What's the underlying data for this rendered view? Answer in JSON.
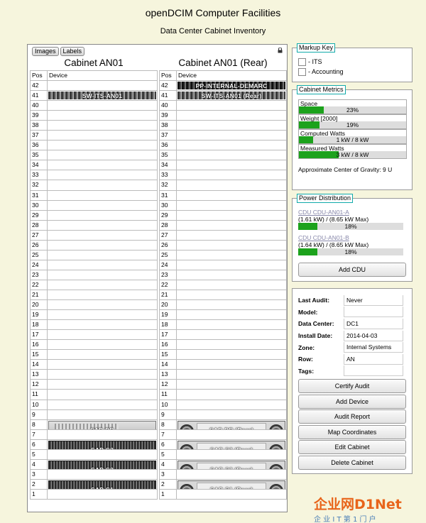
{
  "page": {
    "title": "openDCIM Computer Facilities",
    "subtitle": "Data Center Cabinet Inventory"
  },
  "toolbar": {
    "images_label": "Images",
    "labels_label": "Labels"
  },
  "front": {
    "title": "Cabinet AN01",
    "pos_header": "Pos",
    "device_header": "Device",
    "devices": [
      {
        "name": "SW-ITS-AN01",
        "u": 41,
        "height": 1
      },
      {
        "name": "SAP-DB",
        "u": 7,
        "height": 2
      },
      {
        "name": "SAP-S3",
        "u": 5,
        "height": 2
      },
      {
        "name": "SAP-S2",
        "u": 3,
        "height": 2
      },
      {
        "name": "SAP-S1",
        "u": 1,
        "height": 2
      }
    ]
  },
  "rear": {
    "title": "Cabinet AN01 (Rear)",
    "pos_header": "Pos",
    "device_header": "Device",
    "devices": [
      {
        "name": "PP-INTERNAL-DEMARC",
        "u": 42,
        "height": 1
      },
      {
        "name": "SW-ITS-AN01 (Rear)",
        "u": 41,
        "height": 1
      },
      {
        "name": "SAP-DB (Rear)",
        "u": 7,
        "height": 2
      },
      {
        "name": "SAP-S3 (Rear)",
        "u": 5,
        "height": 2
      },
      {
        "name": "SAP-S2 (Rear)",
        "u": 3,
        "height": 2
      },
      {
        "name": "SAP-S1 (Rear)",
        "u": 1,
        "height": 2
      }
    ]
  },
  "markup_key": {
    "legend": "Markup Key",
    "items": [
      "- ITS",
      "- Accounting"
    ]
  },
  "metrics": {
    "legend": "Cabinet Metrics",
    "items": [
      {
        "label": "Space",
        "value": "23%",
        "pct": 23
      },
      {
        "label": "Weight [2000]",
        "value": "19%",
        "pct": 19
      },
      {
        "label": "Computed Watts",
        "value": "1 kW / 8 kW",
        "pct": 13
      },
      {
        "label": "Measured Watts",
        "value": "3 kW / 8 kW",
        "pct": 37
      }
    ],
    "gravity": "Approximate Center of Gravity: 9 U"
  },
  "power": {
    "legend": "Power Distribution",
    "pdus": [
      {
        "name": "CDU CDU-AN01-A",
        "detail": "(1.61 kW) / (8.65 kW Max)",
        "value": "18%",
        "pct": 18
      },
      {
        "name": "CDU CDU-AN01-B",
        "detail": "(1.64 kW) / (8.65 kW Max)",
        "value": "18%",
        "pct": 18
      }
    ],
    "add_label": "Add CDU"
  },
  "info": {
    "rows": [
      {
        "k": "Last Audit:",
        "v": "Never"
      },
      {
        "k": "Model:",
        "v": ""
      },
      {
        "k": "Data Center:",
        "v": "DC1"
      },
      {
        "k": "Install Date:",
        "v": "2014-04-03"
      },
      {
        "k": "Zone:",
        "v": "Internal Systems"
      },
      {
        "k": "Row:",
        "v": "AN"
      },
      {
        "k": "Tags:",
        "v": ""
      }
    ],
    "buttons": [
      "Certify Audit",
      "Add Device",
      "Audit Report",
      "Map Coordinates",
      "Edit Cabinet",
      "Delete Cabinet"
    ]
  },
  "watermark": {
    "brand": "企业网D1Net",
    "tagline": "企 业 I T 第 1 门 户"
  },
  "colors": {
    "bar_fill": "#1ca21c",
    "legend_border": "#11aaaa",
    "page_bg": "#f6f5dd"
  }
}
